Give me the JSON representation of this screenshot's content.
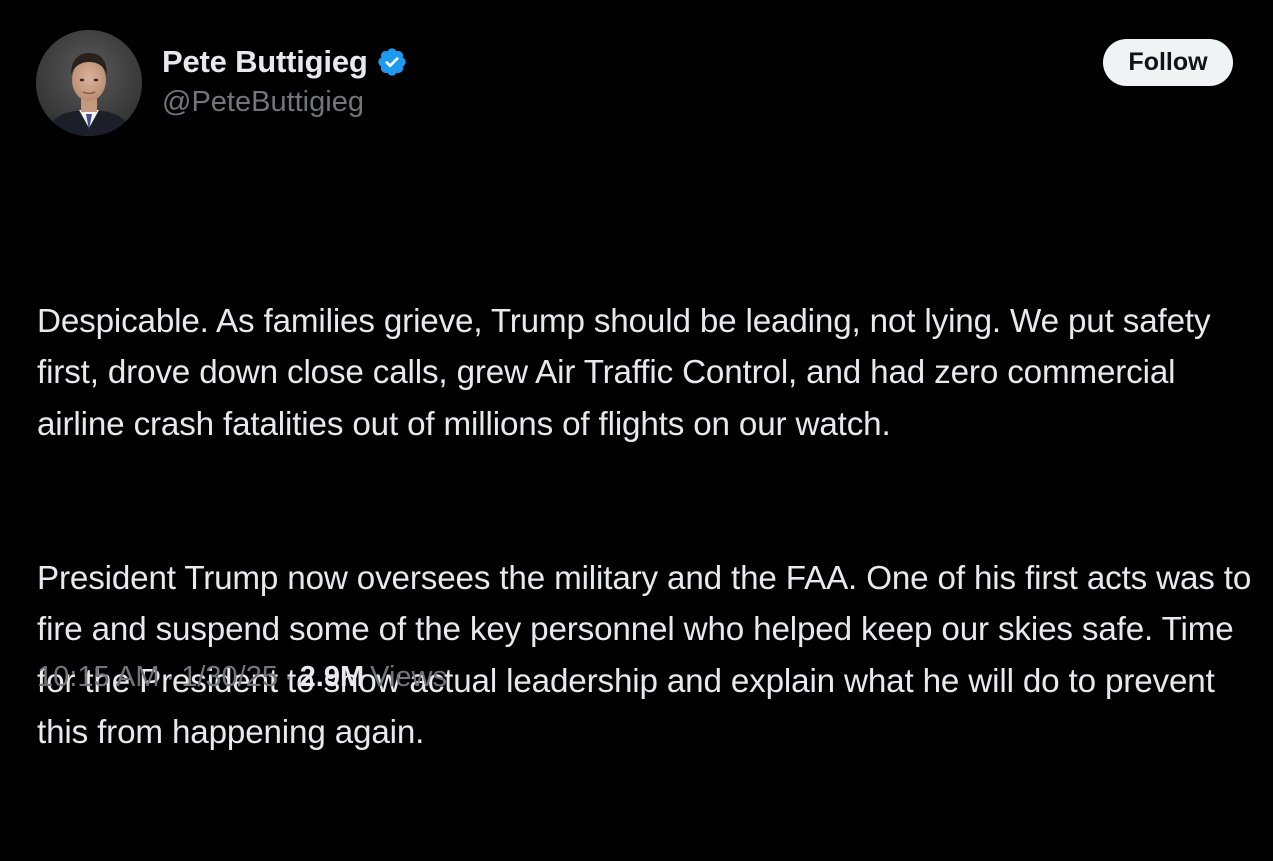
{
  "author": {
    "display_name": "Pete Buttigieg",
    "handle": "@PeteButtigieg",
    "verified": true
  },
  "follow_button": {
    "label": "Follow"
  },
  "tweet": {
    "paragraphs": [
      "Despicable. As families grieve, Trump should be leading, not lying. We put safety first, drove down close calls, grew Air Traffic Control, and had zero commercial airline crash fatalities out of millions of flights on our watch.",
      "President Trump now oversees the military and the FAA. One of his first acts was to fire and suspend some of the key personnel who helped keep our skies safe. Time for the President to show actual leadership and explain what he will do to prevent this from happening again."
    ]
  },
  "meta": {
    "time": "10:15 AM",
    "separator": "·",
    "date": "1/30/25",
    "views_count": "2.9M",
    "views_label": "Views"
  },
  "colors": {
    "background": "#000000",
    "text_primary": "#e7e9ea",
    "text_secondary": "#71767b",
    "verified_badge": "#1d9bf0",
    "follow_button_bg": "#eff3f4"
  },
  "icons": {
    "verified": "verified-badge-icon",
    "avatar": "profile-photo"
  }
}
